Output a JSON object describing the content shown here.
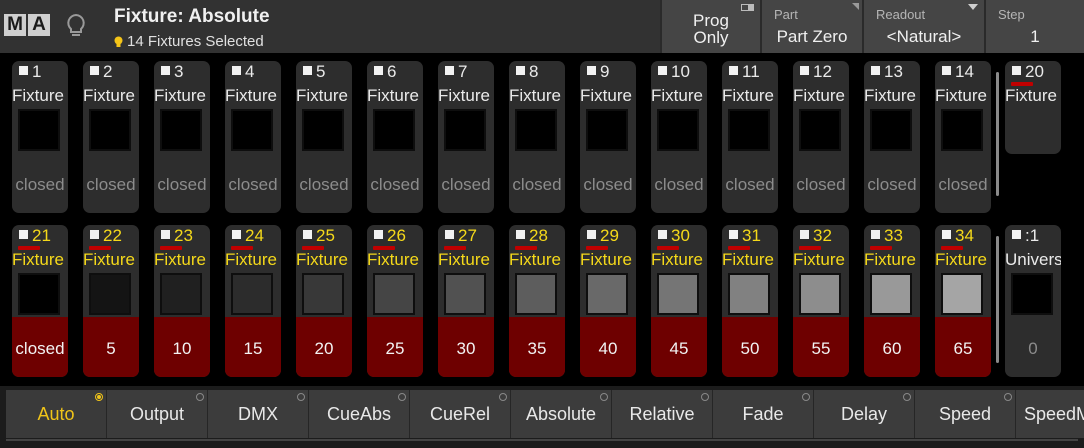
{
  "header": {
    "logo": [
      "M",
      "A"
    ],
    "title": "Fixture: Absolute",
    "subtitle": "14 Fixtures Selected",
    "prog": {
      "line1": "Prog",
      "line2": "Only"
    },
    "part": {
      "label": "Part",
      "value": "Part Zero"
    },
    "readout": {
      "label": "Readout",
      "value": "<Natural>"
    },
    "step": {
      "label": "Step",
      "value": "1"
    }
  },
  "colors": {
    "selected_text": "#f5d91a",
    "selected_bar": "#6e0000",
    "selection_marker": "#c00000",
    "active_tab": "#f0c419"
  },
  "grid": {
    "row1": [
      {
        "id": "1",
        "name": "Fixture",
        "value": "closed",
        "selected": false,
        "level": 0
      },
      {
        "id": "2",
        "name": "Fixture",
        "value": "closed",
        "selected": false,
        "level": 0
      },
      {
        "id": "3",
        "name": "Fixture",
        "value": "closed",
        "selected": false,
        "level": 0
      },
      {
        "id": "4",
        "name": "Fixture",
        "value": "closed",
        "selected": false,
        "level": 0
      },
      {
        "id": "5",
        "name": "Fixture",
        "value": "closed",
        "selected": false,
        "level": 0
      },
      {
        "id": "6",
        "name": "Fixture",
        "value": "closed",
        "selected": false,
        "level": 0
      },
      {
        "id": "7",
        "name": "Fixture",
        "value": "closed",
        "selected": false,
        "level": 0
      },
      {
        "id": "8",
        "name": "Fixture",
        "value": "closed",
        "selected": false,
        "level": 0
      },
      {
        "id": "9",
        "name": "Fixture",
        "value": "closed",
        "selected": false,
        "level": 0
      },
      {
        "id": "10",
        "name": "Fixture",
        "value": "closed",
        "selected": false,
        "level": 0
      },
      {
        "id": "11",
        "name": "Fixture",
        "value": "closed",
        "selected": false,
        "level": 0
      },
      {
        "id": "12",
        "name": "Fixture",
        "value": "closed",
        "selected": false,
        "level": 0
      },
      {
        "id": "13",
        "name": "Fixture",
        "value": "closed",
        "selected": false,
        "level": 0
      },
      {
        "id": "14",
        "name": "Fixture",
        "value": "closed",
        "selected": false,
        "level": 0
      }
    ],
    "row1_side": {
      "id": "20",
      "name": "Fixture",
      "selected": false
    },
    "row2": [
      {
        "id": "21",
        "name": "Fixture",
        "value": "closed",
        "selected": true,
        "level": 0
      },
      {
        "id": "22",
        "name": "Fixture",
        "value": "5",
        "selected": true,
        "level": 5
      },
      {
        "id": "23",
        "name": "Fixture",
        "value": "10",
        "selected": true,
        "level": 10
      },
      {
        "id": "24",
        "name": "Fixture",
        "value": "15",
        "selected": true,
        "level": 15
      },
      {
        "id": "25",
        "name": "Fixture",
        "value": "20",
        "selected": true,
        "level": 20
      },
      {
        "id": "26",
        "name": "Fixture",
        "value": "25",
        "selected": true,
        "level": 25
      },
      {
        "id": "27",
        "name": "Fixture",
        "value": "30",
        "selected": true,
        "level": 30
      },
      {
        "id": "28",
        "name": "Fixture",
        "value": "35",
        "selected": true,
        "level": 35
      },
      {
        "id": "29",
        "name": "Fixture",
        "value": "40",
        "selected": true,
        "level": 40
      },
      {
        "id": "30",
        "name": "Fixture",
        "value": "45",
        "selected": true,
        "level": 45
      },
      {
        "id": "31",
        "name": "Fixture",
        "value": "50",
        "selected": true,
        "level": 50
      },
      {
        "id": "32",
        "name": "Fixture",
        "value": "55",
        "selected": true,
        "level": 55
      },
      {
        "id": "33",
        "name": "Fixture",
        "value": "60",
        "selected": true,
        "level": 60
      },
      {
        "id": "34",
        "name": "Fixture",
        "value": "65",
        "selected": true,
        "level": 65
      }
    ],
    "row2_side": {
      "id": ":1",
      "name": "Universe",
      "value": "0",
      "selected": false
    }
  },
  "tabs": [
    {
      "label": "Auto",
      "active": true
    },
    {
      "label": "Output",
      "active": false
    },
    {
      "label": "DMX",
      "active": false
    },
    {
      "label": "CueAbs",
      "active": false
    },
    {
      "label": "CueRel",
      "active": false
    },
    {
      "label": "Absolute",
      "active": false
    },
    {
      "label": "Relative",
      "active": false
    },
    {
      "label": "Fade",
      "active": false
    },
    {
      "label": "Delay",
      "active": false
    },
    {
      "label": "Speed",
      "active": false
    },
    {
      "label": "SpeedMaster",
      "active": false
    }
  ]
}
